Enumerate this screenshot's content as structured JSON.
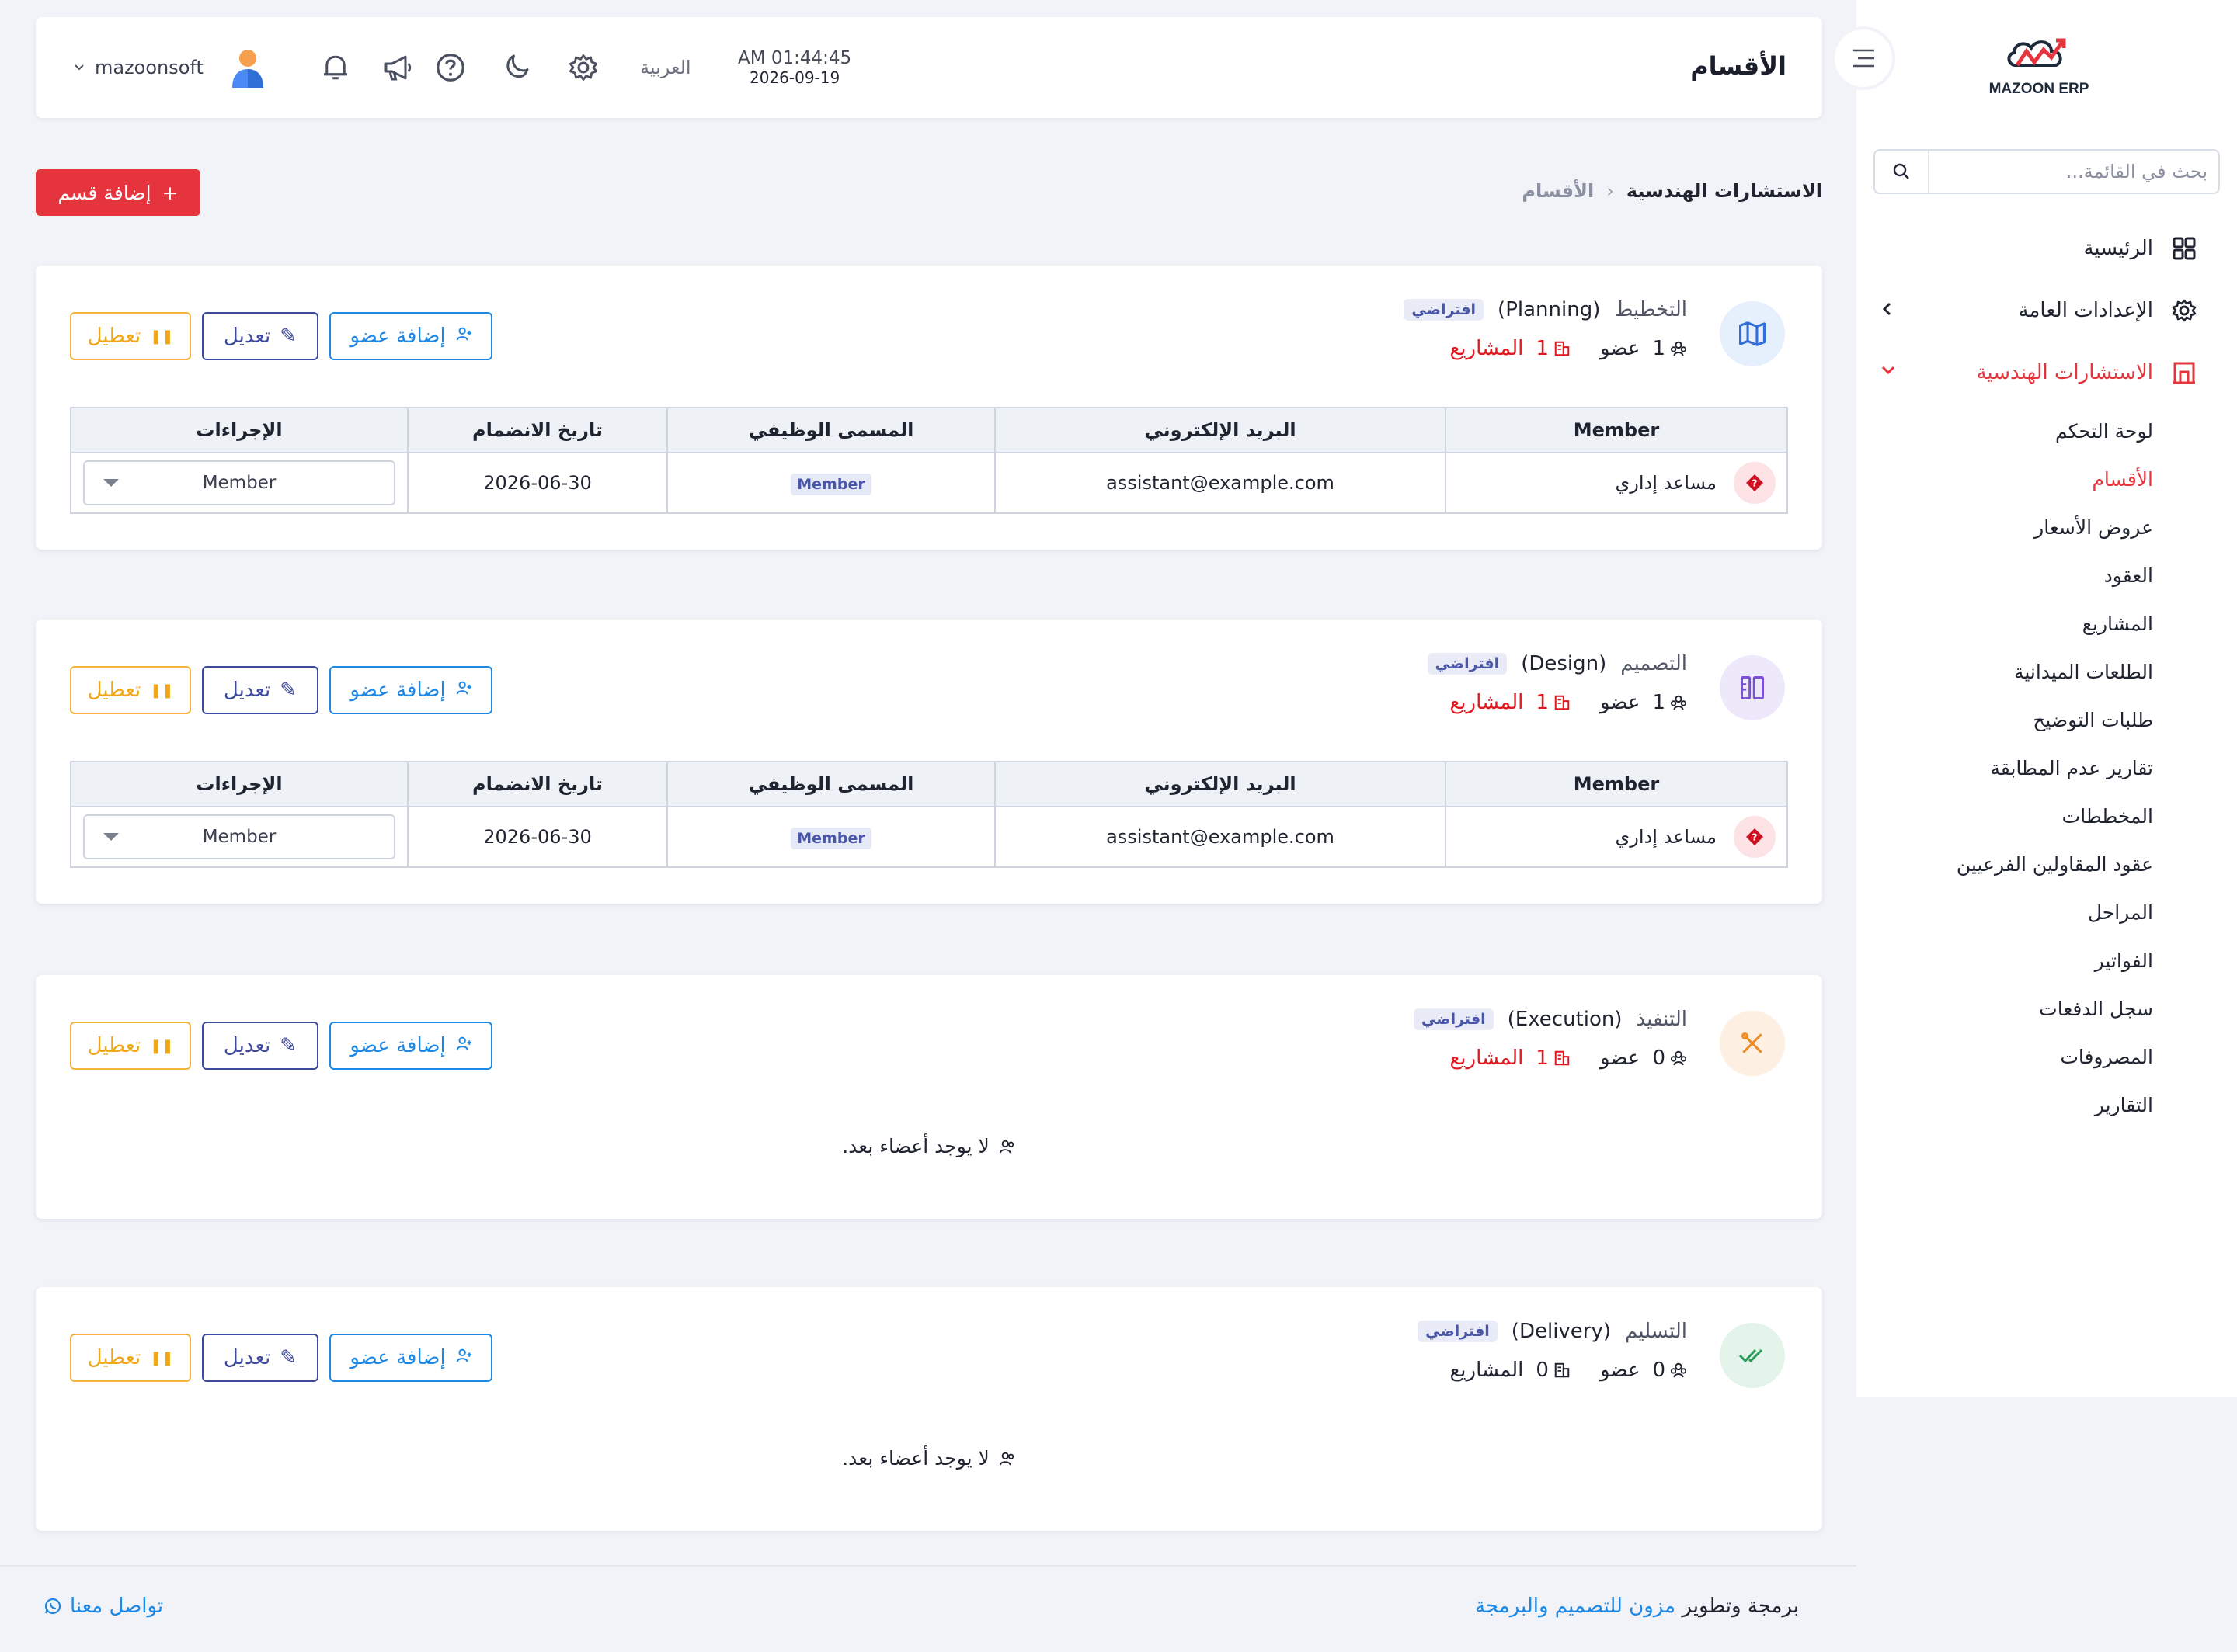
{
  "app": {
    "logo_text": "MAZOON ERP",
    "page_title": "الأقسام"
  },
  "header": {
    "time": "AM 01:44:45",
    "date": "2026-09-19",
    "language": "العربية",
    "username": "mazoonsoft"
  },
  "sidebar": {
    "search_placeholder": "بحث في القائمة...",
    "items": [
      {
        "label": "الرئيسية",
        "icon": "grid-icon"
      },
      {
        "label": "الإعدادات العامة",
        "icon": "gear-icon"
      },
      {
        "label": "الاستشارات الهندسية",
        "icon": "building-icon",
        "active": true
      }
    ],
    "subitems": [
      {
        "label": "لوحة التحكم"
      },
      {
        "label": "الأقسام",
        "active": true
      },
      {
        "label": "عروض الأسعار"
      },
      {
        "label": "العقود"
      },
      {
        "label": "المشاريع"
      },
      {
        "label": "الطلعات الميدانية"
      },
      {
        "label": "طلبات التوضيح"
      },
      {
        "label": "تقارير عدم المطابقة"
      },
      {
        "label": "المخططات"
      },
      {
        "label": "عقود المقاولين الفرعيين"
      },
      {
        "label": "المراحل"
      },
      {
        "label": "الفواتير"
      },
      {
        "label": "سجل الدفعات"
      },
      {
        "label": "المصروفات"
      },
      {
        "label": "التقارير"
      }
    ]
  },
  "breadcrumb": {
    "parent": "الاستشارات الهندسية",
    "current": "الأقسام"
  },
  "add_section_label": "إضافة قسم",
  "actions": {
    "add_member": "إضافة عضو",
    "edit": "تعديل",
    "disable": "تعطيل"
  },
  "table_headers": {
    "member": "Member",
    "email": "البريد الإلكتروني",
    "job_title": "المسمى الوظيفي",
    "join_date": "تاريخ الانضمام",
    "actions": "الإجراءات"
  },
  "labels": {
    "member_word": "عضو",
    "projects_word": "المشاريع",
    "default_badge": "افتراضي",
    "empty_members": "لا يوجد أعضاء بعد."
  },
  "departments": [
    {
      "name": "التخطيط",
      "name_en": "(Planning)",
      "members": "1",
      "projects": "1",
      "icon": "map-icon",
      "icon_color": "#2f6fd6",
      "rows": [
        {
          "name": "مساعد إداري",
          "email": "assistant@example.com",
          "job_title": "Member",
          "join_date": "2026-06-30",
          "role": "Member"
        }
      ]
    },
    {
      "name": "التصميم",
      "name_en": "(Design)",
      "members": "1",
      "projects": "1",
      "icon": "design-tools-icon",
      "icon_color": "#7b4fd6",
      "rows": [
        {
          "name": "مساعد إداري",
          "email": "assistant@example.com",
          "job_title": "Member",
          "join_date": "2026-06-30",
          "role": "Member"
        }
      ]
    },
    {
      "name": "التنفيذ",
      "name_en": "(Execution)",
      "members": "0",
      "projects": "1",
      "icon": "tools-icon",
      "icon_color": "#f08a24",
      "rows": []
    },
    {
      "name": "التسليم",
      "name_en": "(Delivery)",
      "members": "0",
      "projects": "0",
      "icon": "double-check-icon",
      "icon_color": "#2a9d5c",
      "rows": []
    }
  ],
  "footer": {
    "dev_prefix": "برمجة وتطوير",
    "dev_link": "مزون للتصميم والبرمجة",
    "contact": "تواصل معنا"
  }
}
